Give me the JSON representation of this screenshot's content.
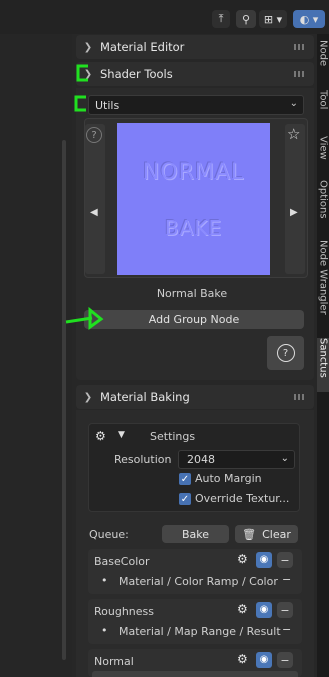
{
  "colors": {
    "accent": "#4772b3",
    "annotation": "#20e020",
    "normal_map": "#7f7ff9"
  },
  "topbar": {
    "icons": [
      "transform-icon",
      "snap-icon",
      "proportional-icon",
      "overlay-icon"
    ]
  },
  "tabs": [
    "Node",
    "Tool",
    "View",
    "Options",
    "Node Wrangler",
    "Sanctus"
  ],
  "active_tab": "Sanctus",
  "material_editor": {
    "title": "Material Editor"
  },
  "shader_tools": {
    "title": "Shader Tools",
    "dropdown_value": "Utils",
    "preview_text_1": "NORMAL",
    "preview_text_2": "BAKE",
    "item_name": "Normal Bake",
    "add_group_label": "Add Group Node",
    "help_symbol": "?"
  },
  "material_baking": {
    "title": "Material Baking",
    "settings_label": "Settings",
    "resolution_label": "Resolution",
    "resolution_value": "2048",
    "auto_margin_label": "Auto Margin",
    "override_label": "Override Textur...",
    "queue_label": "Queue:",
    "bake_label": "Bake",
    "clear_label": "Clear",
    "queue": [
      {
        "name": "BaseColor",
        "detail": "Material / Color Ramp / Color"
      },
      {
        "name": "Roughness",
        "detail": "Material / Map Range / Result"
      },
      {
        "name": "Normal",
        "detail": ""
      }
    ]
  }
}
